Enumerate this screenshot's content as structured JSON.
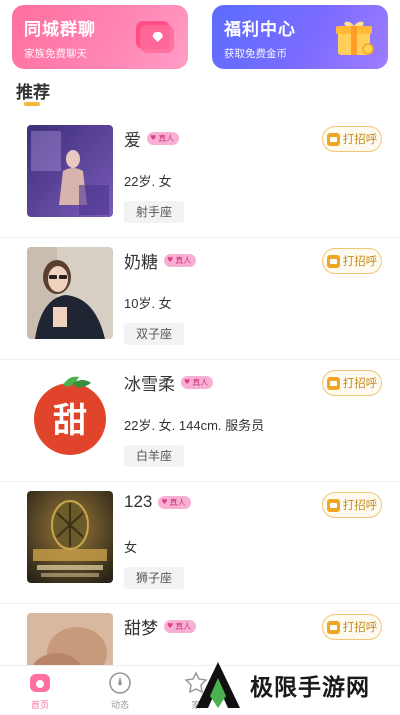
{
  "banners": [
    {
      "title": "同城群聊",
      "subtitle": "家族免费聊天"
    },
    {
      "title": "福利中心",
      "subtitle": "获取免费金币"
    }
  ],
  "section": {
    "title": "推荐"
  },
  "badge_label": "真人",
  "greet_label": "打招呼",
  "users": [
    {
      "name": "爱",
      "desc": "22岁. 女",
      "tag": "射手座"
    },
    {
      "name": "奶糖",
      "desc": "10岁. 女",
      "tag": "双子座"
    },
    {
      "name": "冰雪柔",
      "desc": "22岁. 女. 144cm. 服务员",
      "tag": "白羊座"
    },
    {
      "name": "123",
      "desc": "女",
      "tag": "狮子座"
    },
    {
      "name": "甜梦",
      "desc": "",
      "tag": ""
    }
  ],
  "avatar_texts": {
    "sweet": "甜"
  },
  "nav": [
    {
      "label": "首页",
      "icon": "home-icon"
    },
    {
      "label": "动态",
      "icon": "feed-icon"
    },
    {
      "label": "家",
      "icon": "family-icon"
    }
  ],
  "watermark": {
    "text": "极限手游网"
  },
  "colors": {
    "accent_yellow": "#f9b53a",
    "pink": "#ff6fa0",
    "purple": "#6e6cff"
  }
}
